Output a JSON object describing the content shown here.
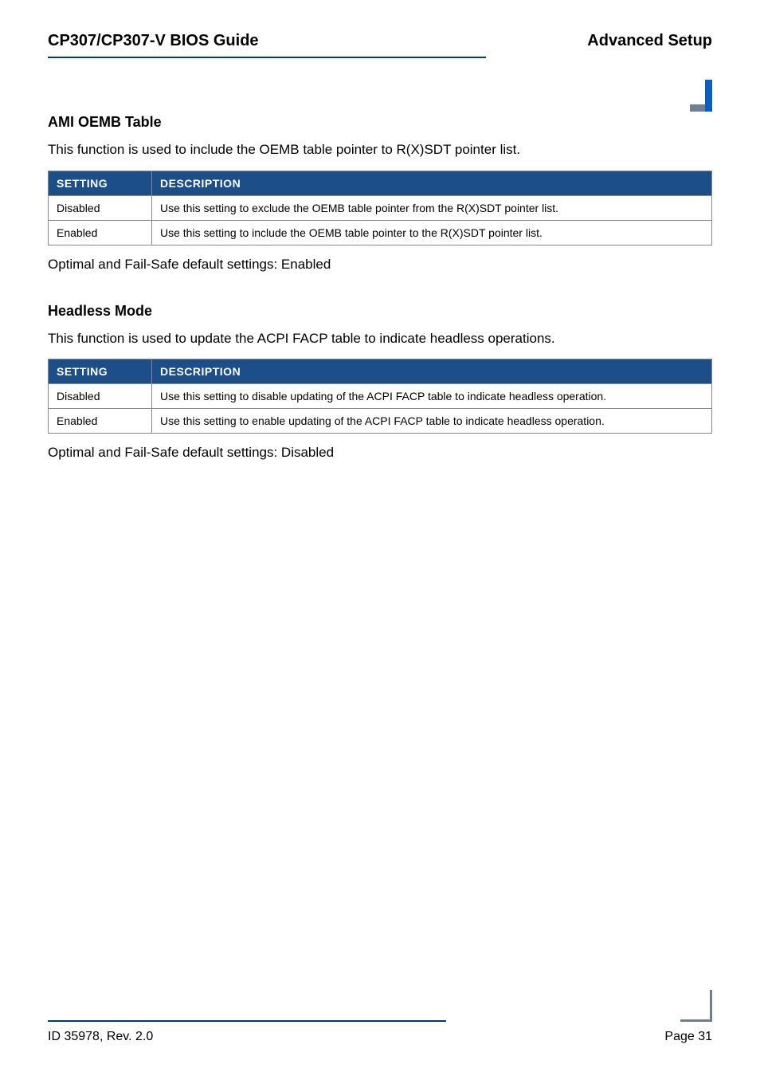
{
  "header": {
    "left": "CP307/CP307-V BIOS Guide",
    "right": "Advanced Setup"
  },
  "sections": [
    {
      "heading": "AMI OEMB Table",
      "intro": "This function is used to include the OEMB table pointer to R(X)SDT pointer list.",
      "th_setting": "SETTING",
      "th_desc": "DESCRIPTION",
      "rows": [
        {
          "setting": "Disabled",
          "desc": "Use this setting to exclude the OEMB table pointer from the R(X)SDT pointer list."
        },
        {
          "setting": "Enabled",
          "desc": "Use this setting to include the OEMB table pointer to the R(X)SDT pointer list."
        }
      ],
      "note": "Optimal and Fail-Safe default settings: Enabled"
    },
    {
      "heading": "Headless Mode",
      "intro": "This function is used to update the ACPI FACP table to indicate headless operations.",
      "th_setting": "SETTING",
      "th_desc": "DESCRIPTION",
      "rows": [
        {
          "setting": "Disabled",
          "desc": "Use this setting to disable updating of the ACPI FACP table to indicate headless operation."
        },
        {
          "setting": "Enabled",
          "desc": "Use this setting to enable updating of the ACPI FACP table to indicate headless operation."
        }
      ],
      "note": "Optimal and Fail-Safe default settings: Disabled"
    }
  ],
  "footer": {
    "left": "ID 35978, Rev. 2.0",
    "right": "Page 31"
  }
}
